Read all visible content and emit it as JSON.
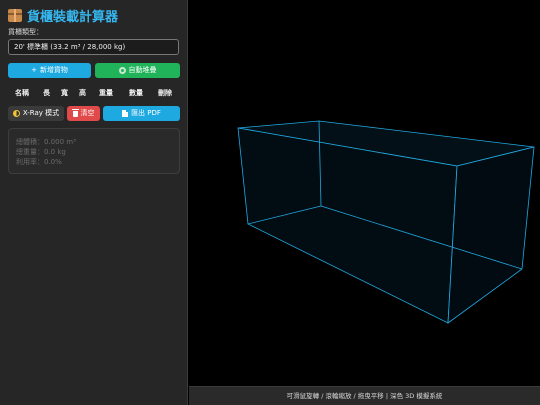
{
  "app": {
    "title": "貨櫃裝載計算器",
    "title_icon": "package-icon"
  },
  "container": {
    "label": "貨櫃類型：",
    "selected": "20' 標準櫃 (33.2 m³ / 28,000 kg)"
  },
  "actions": {
    "add": "新增貨物",
    "auto": "自動堆疊",
    "xray": "X-Ray 模式",
    "clear": "清空",
    "pdf": "匯出 PDF"
  },
  "table": {
    "headers": [
      "名稱",
      "長",
      "寬",
      "高",
      "重量",
      "數量",
      "刪除"
    ]
  },
  "summary": {
    "volume": "總體積：0.000 m³",
    "weight": "總重量：0.0 kg",
    "utilization": "利用率：0.0%"
  },
  "viewport": {
    "hint": "可滑鼠旋轉 / 滾輪縮放 / 拖曳平移 | 深色 3D 模擬系統",
    "edge_color": "#1fa9e1"
  },
  "colors": {
    "accent": "#35b6ee",
    "add_button": "#1fa9e1",
    "auto_button": "#21b35a",
    "clear_button": "#e04a4a",
    "panel_bg": "#262626"
  }
}
